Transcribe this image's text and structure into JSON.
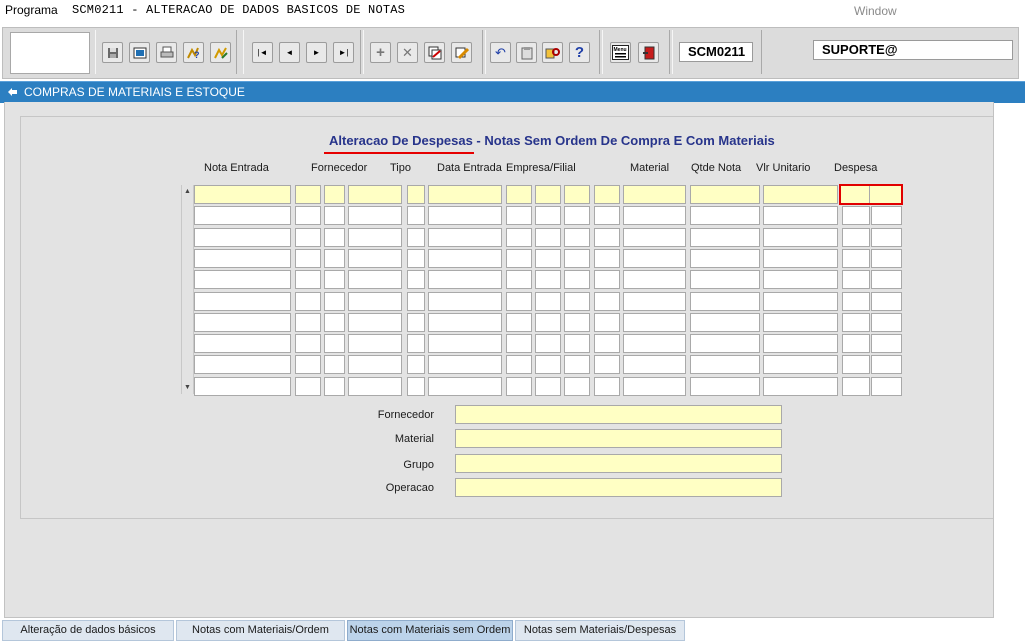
{
  "menubar": {
    "programa": "Programa",
    "title": "SCM0211 - ALTERACAO DE DADOS BASICOS DE NOTAS",
    "window": "Window"
  },
  "toolbar": {
    "form_code": "SCM0211",
    "user": "SUPORTE@",
    "buttons": [
      "save-icon",
      "print-preview-icon",
      "print-icon",
      "help-query-icon",
      "execute-query-icon",
      "first-record-icon",
      "previous-record-icon",
      "next-record-icon",
      "last-record-icon",
      "insert-record-icon",
      "delete-record-icon",
      "duplicate-record-icon",
      "clear-record-icon",
      "undo-icon",
      "paste-icon",
      "zoom-icon",
      "help-icon",
      "menu-icon",
      "exit-icon"
    ],
    "menu_label": "Menu"
  },
  "header": {
    "title": "COMPRAS DE MATERIAIS E ESTOQUE"
  },
  "form": {
    "title_part1": "Alteracao De Despesas",
    "title_part2": " - Notas Sem Ordem De Compra E Com Materiais",
    "columns": [
      "Nota Entrada",
      "Fornecedor",
      "Tipo",
      "Data Entrada",
      "Empresa/Filial",
      "Material",
      "Qtde Nota",
      "Vlr Unitario",
      "Despesa"
    ]
  },
  "fields": {
    "fornecedor": "Fornecedor",
    "material": "Material",
    "grupo": "Grupo",
    "operacao": "Operacao"
  },
  "tabs": [
    {
      "label": "Alteração de dados básicos",
      "active": false
    },
    {
      "label": "Notas com Materiais/Ordem",
      "active": false
    },
    {
      "label": "Notas com Materiais sem Ordem",
      "active": true
    },
    {
      "label": "Notas sem Materiais/Despesas",
      "active": false
    }
  ],
  "colors": {
    "header": "#2c7fc1",
    "title": "#27348b",
    "focus": "#e10000",
    "highlight": "#ffffc4"
  }
}
